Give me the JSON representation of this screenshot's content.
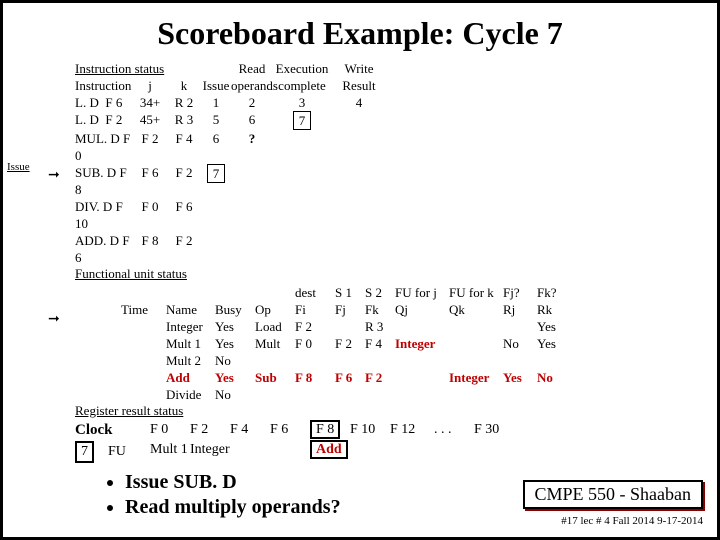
{
  "title": "Scoreboard Example:  Cycle 7",
  "issue_label": "Issue",
  "instr_status_label": "Instruction status",
  "hdr": {
    "instr": "Instruction",
    "j": "j",
    "k": "k",
    "issue": "Issue",
    "read": "Read",
    "oper": "operands",
    "exec": "Execution",
    "comp": "complete",
    "write": "Write",
    "result": "Result"
  },
  "instructions": [
    {
      "op": "L. D",
      "fi": "F 6",
      "j": "34+",
      "k": "R 2",
      "issue": "1",
      "read": "2",
      "exec": "3",
      "write": "4"
    },
    {
      "op": "L. D",
      "fi": "F 2",
      "j": "45+",
      "k": "R 3",
      "issue": "5",
      "read": "6",
      "exec": "7",
      "write": ""
    },
    {
      "op": "MUL. D",
      "fi": "F 0",
      "j": "F 2",
      "k": "F 4",
      "issue": "6",
      "read": "?",
      "exec": "",
      "write": ""
    },
    {
      "op": "SUB. D",
      "fi": "F 8",
      "j": "F 6",
      "k": "F 2",
      "issue": "7",
      "read": "",
      "exec": "",
      "write": ""
    },
    {
      "op": "DIV. D",
      "fi": "F 10",
      "j": "F 0",
      "k": "F 6",
      "issue": "",
      "read": "",
      "exec": "",
      "write": ""
    },
    {
      "op": "ADD. D",
      "fi": "F 6",
      "j": "F 8",
      "k": "F 2",
      "issue": "",
      "read": "",
      "exec": "",
      "write": ""
    }
  ],
  "fu_status_label": "Functional unit status",
  "fu_hdr": {
    "time": "Time",
    "name": "Name",
    "busy": "Busy",
    "op": "Op",
    "dest": "dest",
    "fi": "Fi",
    "s1": "S 1",
    "fj": "Fj",
    "s2": "S 2",
    "fk": "Fk",
    "fuj": "FU for j",
    "qj": "Qj",
    "fuk": "FU for k",
    "qk": "Qk",
    "rjq": "Fj?",
    "rj": "Rj",
    "rkq": "Fk?",
    "rk": "Rk"
  },
  "fu": [
    {
      "name": "Integer",
      "busy": "Yes",
      "op": "Load",
      "fi": "F 2",
      "fj": "",
      "fk": "R 3",
      "qj": "",
      "qk": "",
      "rj": "",
      "rk": "Yes"
    },
    {
      "name": "Mult 1",
      "busy": "Yes",
      "op": "Mult",
      "fi": "F 0",
      "fj": "F 2",
      "fk": "F 4",
      "qj": "Integer",
      "qk": "",
      "rj": "No",
      "rk": "Yes"
    },
    {
      "name": "Mult 2",
      "busy": "No",
      "op": "",
      "fi": "",
      "fj": "",
      "fk": "",
      "qj": "",
      "qk": "",
      "rj": "",
      "rk": ""
    },
    {
      "name": "Add",
      "busy": "Yes",
      "op": "Sub",
      "fi": "F 8",
      "fj": "F 6",
      "fk": "F 2",
      "qj": "",
      "qk": "Integer",
      "rj": "Yes",
      "rk": "No"
    },
    {
      "name": "Divide",
      "busy": "No",
      "op": "",
      "fi": "",
      "fj": "",
      "fk": "",
      "qj": "",
      "qk": "",
      "rj": "",
      "rk": ""
    }
  ],
  "reg_status_label": "Register result status",
  "clock_label": "Clock",
  "clock_val": "7",
  "fu_label": "FU",
  "regs": {
    "f0": "F 0",
    "f2": "F 2",
    "f4": "F 4",
    "f6": "F 6",
    "f8": "F 8",
    "f10": "F 10",
    "f12": "F 12",
    "dots": ". . .",
    "f30": "F 30"
  },
  "reg_fu": {
    "f0": "Mult 1",
    "f2": "Integer",
    "f8": "Add"
  },
  "bullets": [
    "Issue SUB. D",
    "Read multiply operands?"
  ],
  "footer": {
    "course": "CMPE 550 - Shaaban",
    "meta": "#17   lec # 4 Fall 2014   9-17-2014"
  }
}
